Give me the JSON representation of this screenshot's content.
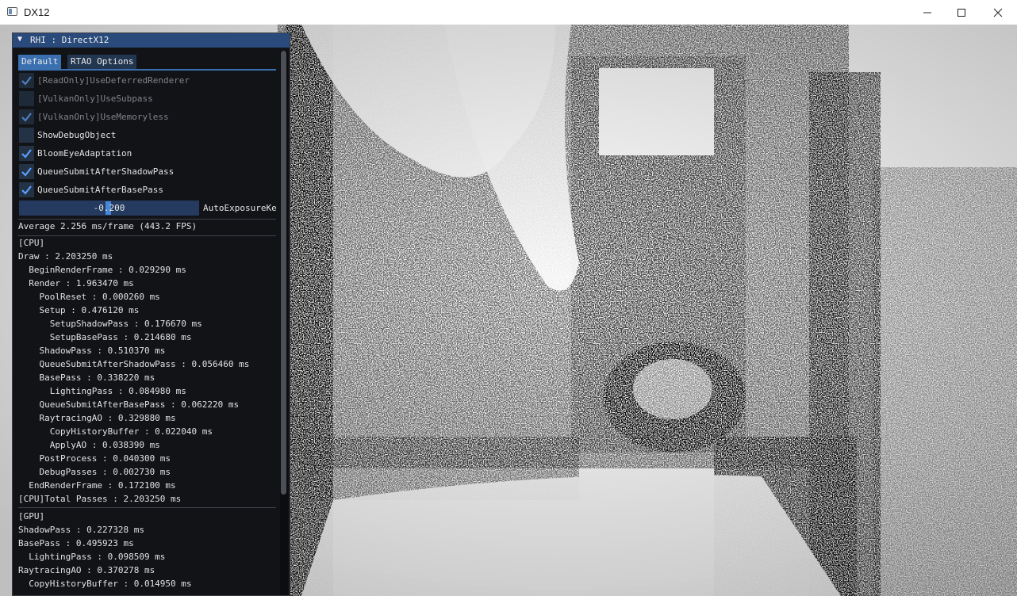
{
  "window": {
    "title": "DX12",
    "icon": "app-window-icon",
    "controls": [
      "minimize-icon",
      "maximize-icon",
      "close-icon"
    ]
  },
  "panel": {
    "header": "RHI : DirectX12",
    "tabs": [
      {
        "label": "Default",
        "active": true
      },
      {
        "label": "RTAO Options",
        "active": false
      }
    ],
    "checkboxes": [
      {
        "label": "[ReadOnly]UseDeferredRenderer",
        "checked": true,
        "disabled": true
      },
      {
        "label": "[VulkanOnly]UseSubpass",
        "checked": false,
        "disabled": true
      },
      {
        "label": "[VulkanOnly]UseMemoryless",
        "checked": true,
        "disabled": true
      },
      {
        "label": "ShowDebugObject",
        "checked": false,
        "disabled": false
      },
      {
        "label": "BloomEyeAdaptation",
        "checked": true,
        "disabled": false
      },
      {
        "label": "QueueSubmitAfterShadowPass",
        "checked": true,
        "disabled": false
      },
      {
        "label": "QueueSubmitAfterBasePass",
        "checked": true,
        "disabled": false
      }
    ],
    "slider": {
      "value": "-0.200",
      "label": "AutoExposureKe"
    },
    "average": "Average 2.256 ms/frame (443.2 FPS)",
    "cpu_lines": [
      "[CPU]",
      "Draw : 2.203250 ms",
      "  BeginRenderFrame : 0.029290 ms",
      "  Render : 1.963470 ms",
      "    PoolReset : 0.000260 ms",
      "    Setup : 0.476120 ms",
      "      SetupShadowPass : 0.176670 ms",
      "      SetupBasePass : 0.214680 ms",
      "    ShadowPass : 0.510370 ms",
      "    QueueSubmitAfterShadowPass : 0.056460 ms",
      "    BasePass : 0.338220 ms",
      "      LightingPass : 0.084980 ms",
      "    QueueSubmitAfterBasePass : 0.062220 ms",
      "    RaytracingAO : 0.329880 ms",
      "      CopyHistoryBuffer : 0.022040 ms",
      "      ApplyAO : 0.038390 ms",
      "    PostProcess : 0.040300 ms",
      "    DebugPasses : 0.002730 ms",
      "  EndRenderFrame : 0.172100 ms",
      "[CPU]Total Passes : 2.203250 ms"
    ],
    "gpu_lines": [
      "[GPU]",
      "ShadowPass : 0.227328 ms",
      "BasePass : 0.495923 ms",
      "  LightingPass : 0.098509 ms",
      "RaytracingAO : 0.370278 ms",
      "  CopyHistoryBuffer : 0.014950 ms"
    ]
  },
  "colors": {
    "panel_bg": "#121317",
    "header_bg": "#294a7a",
    "accent": "#3a6fb0",
    "check": "#5aa0ff"
  }
}
